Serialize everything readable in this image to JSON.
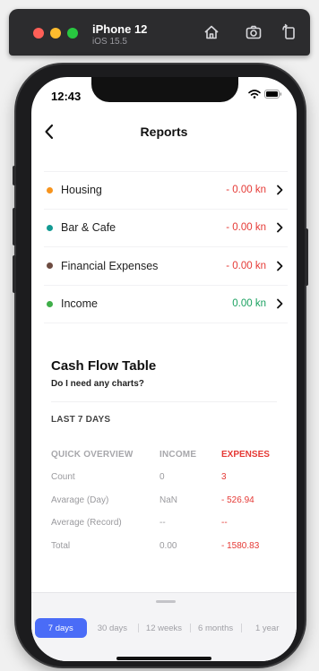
{
  "simulator": {
    "device_name": "iPhone 12",
    "os_version": "iOS 15.5",
    "buttons": [
      "home-icon",
      "screenshot-icon",
      "rotate-icon"
    ]
  },
  "status_bar": {
    "time": "12:43"
  },
  "nav": {
    "title": "Reports"
  },
  "categories": [
    {
      "label": "Housing",
      "amount": "- 0.00 kn",
      "dot_color": "#f7941d",
      "amount_color": "#e53935"
    },
    {
      "label": "Bar & Cafe",
      "amount": "- 0.00 kn",
      "dot_color": "#139a93",
      "amount_color": "#e53935"
    },
    {
      "label": "Financial Expenses",
      "amount": "- 0.00 kn",
      "dot_color": "#6d4c41",
      "amount_color": "#e53935"
    },
    {
      "label": "Income",
      "amount": "0.00 kn",
      "dot_color": "#3fae49",
      "amount_color": "#1aa160"
    }
  ],
  "cash_flow": {
    "title": "Cash Flow Table",
    "subtitle": "Do I need any charts?",
    "period": "LAST 7 DAYS",
    "headers": [
      "QUICK OVERVIEW",
      "INCOME",
      "EXPENSES"
    ],
    "rows": [
      {
        "label": "Count",
        "income": "0",
        "expenses": "3"
      },
      {
        "label": "Avarage (Day)",
        "income": "NaN",
        "expenses": "- 526.94"
      },
      {
        "label": "Average (Record)",
        "income": "--",
        "expenses": "--"
      },
      {
        "label": "Total",
        "income": "0.00",
        "expenses": "- 1580.83"
      }
    ]
  },
  "period_selector": {
    "options": [
      "7 days",
      "30 days",
      "12 weeks",
      "6 months",
      "1 year"
    ],
    "selected": "7 days"
  },
  "colors": {
    "accent": "#4a6cf7",
    "expense": "#e53935",
    "income": "#1aa160"
  }
}
